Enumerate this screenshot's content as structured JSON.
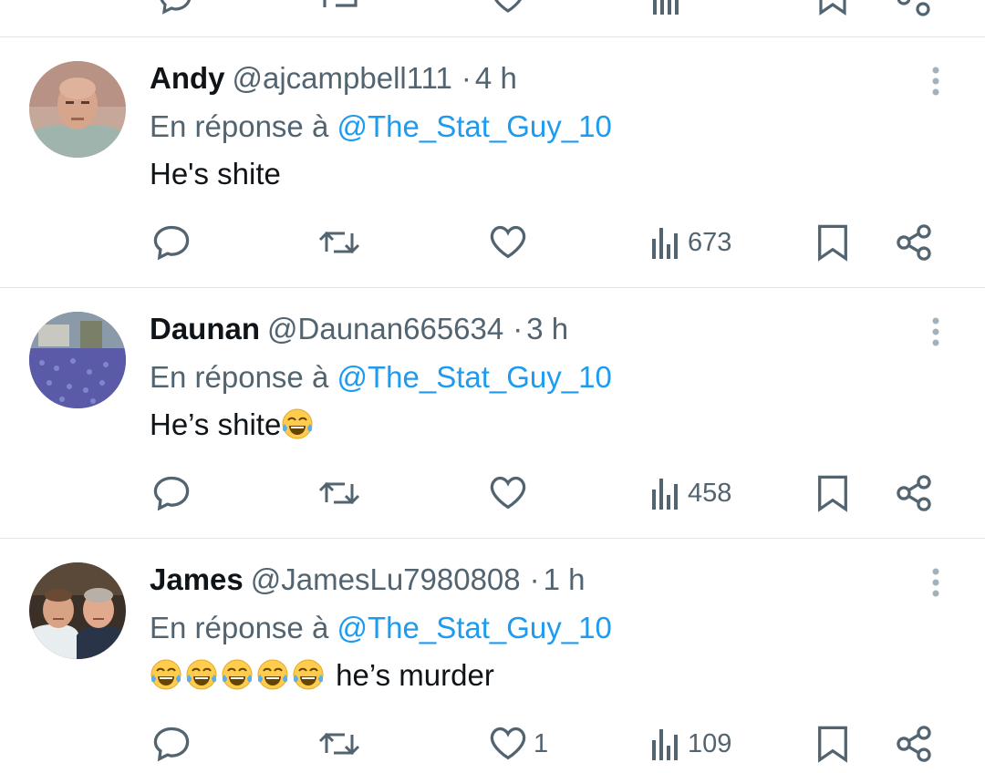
{
  "tweets": [
    {
      "display_name": "Andy",
      "handle": "@ajcampbell111",
      "time": "4 h",
      "reply_prefix": "En réponse à",
      "reply_to": "@The_Stat_Guy_10",
      "text": "He's shite",
      "emoji_suffix_count": 0,
      "emoji_prefix_count": 0,
      "likes": "",
      "views": "673",
      "avatar": "bald-man-photo"
    },
    {
      "display_name": "Daunan",
      "handle": "@Daunan665634",
      "time": "3 h",
      "reply_prefix": "En réponse à",
      "reply_to": "@The_Stat_Guy_10",
      "text": "He’s shite",
      "emoji_suffix_count": 1,
      "emoji_prefix_count": 0,
      "likes": "",
      "views": "458",
      "avatar": "crowd-aerial-photo"
    },
    {
      "display_name": "James",
      "handle": "@JamesLu7980808",
      "time": "1 h",
      "reply_prefix": "En réponse à",
      "reply_to": "@The_Stat_Guy_10",
      "text": "he’s murder",
      "emoji_suffix_count": 0,
      "emoji_prefix_count": 5,
      "likes": "1",
      "views": "109",
      "avatar": "two-men-photo"
    }
  ],
  "icons": {
    "reply": "speech-bubble-icon",
    "retweet": "retweet-arrows-icon",
    "like": "heart-icon",
    "views": "bar-chart-icon",
    "bookmark": "bookmark-icon",
    "share": "share-icon",
    "more": "vertical-dots-icon",
    "emoji": "tears-of-joy-emoji"
  },
  "colors": {
    "text": "#0f1419",
    "secondary": "#536471",
    "mention": "#1d9bf0",
    "divider": "#dfe5e8"
  }
}
